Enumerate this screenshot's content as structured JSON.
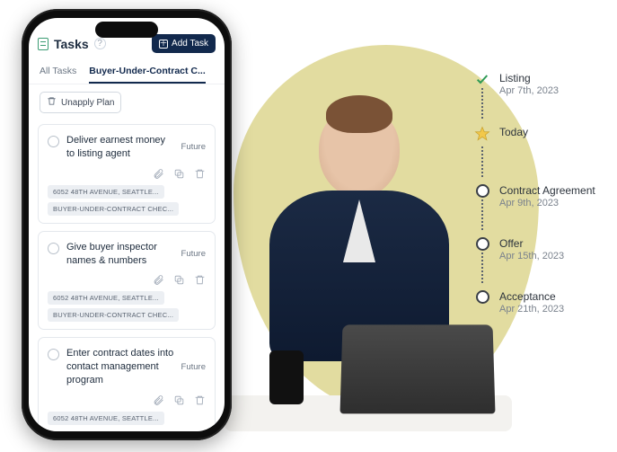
{
  "app": {
    "title": "Tasks",
    "add_task_label": "Add Task"
  },
  "tabs": {
    "all": "All Tasks",
    "active": "Buyer-Under-Contract C..."
  },
  "planbar": {
    "unapply_label": "Unapply Plan"
  },
  "tasks": [
    {
      "title": "Deliver earnest money to listing agent",
      "status": "Future",
      "chips": [
        "6052 48TH AVENUE, SEATTLE...",
        "BUYER-UNDER-CONTRACT CHEC..."
      ]
    },
    {
      "title": "Give buyer inspector names & numbers",
      "status": "Future",
      "chips": [
        "6052 48TH AVENUE, SEATTLE...",
        "BUYER-UNDER-CONTRACT CHEC..."
      ]
    },
    {
      "title": "Enter contract dates into contact management program",
      "status": "Future",
      "chips": [
        "6052 48TH AVENUE, SEATTLE..."
      ]
    }
  ],
  "timeline": [
    {
      "label": "Listing",
      "date": "Apr 7th, 2023",
      "kind": "done"
    },
    {
      "label": "Today",
      "date": "",
      "kind": "today"
    },
    {
      "label": "Contract Agreement",
      "date": "Apr 9th, 2023",
      "kind": "future"
    },
    {
      "label": "Offer",
      "date": "Apr 15th, 2023",
      "kind": "future"
    },
    {
      "label": "Acceptance",
      "date": "Apr 21th, 2023",
      "kind": "future"
    }
  ]
}
